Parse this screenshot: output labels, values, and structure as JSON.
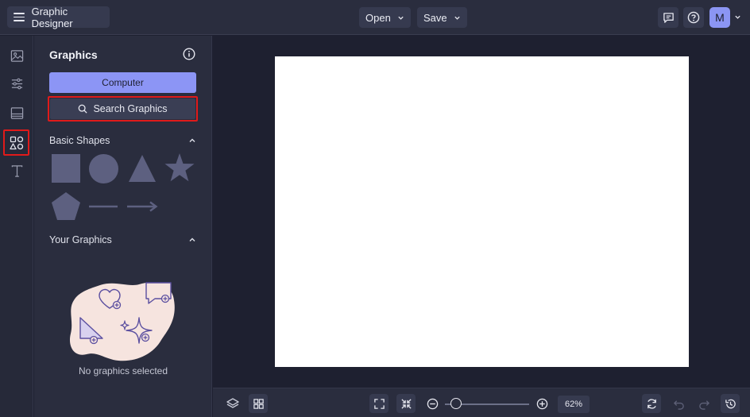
{
  "header": {
    "app_title": "Graphic Designer",
    "open_label": "Open",
    "save_label": "Save",
    "avatar_initial": "M"
  },
  "panel": {
    "title": "Graphics",
    "computer_label": "Computer",
    "search_label": "Search Graphics",
    "basic_shapes_label": "Basic Shapes",
    "your_graphics_label": "Your Graphics",
    "empty_text": "No graphics selected"
  },
  "zoom": {
    "value": "62",
    "unit": "%"
  },
  "colors": {
    "accent": "#8c95f5",
    "highlight": "#e01a1a",
    "shape_fill": "#5d6080",
    "artboard": "#ffffff"
  }
}
